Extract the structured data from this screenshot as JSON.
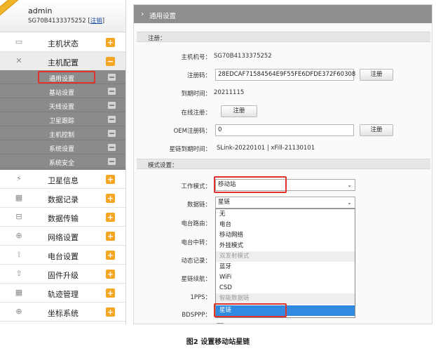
{
  "user": {
    "name": "admin",
    "serial": "SG70B4133375252",
    "logout_label": "注销"
  },
  "sidebar": {
    "items": [
      {
        "label": "主机状态",
        "icon": "monitor-icon",
        "badge": "+"
      },
      {
        "label": "主机配置",
        "icon": "tools-icon",
        "badge": "−"
      },
      {
        "label": "卫星信息",
        "icon": "satellite-icon",
        "badge": "+"
      },
      {
        "label": "数据记录",
        "icon": "calendar-icon",
        "badge": "+"
      },
      {
        "label": "数据传输",
        "icon": "transfer-icon",
        "badge": "+"
      },
      {
        "label": "网络设置",
        "icon": "globe-icon",
        "badge": "+"
      },
      {
        "label": "电台设置",
        "icon": "antenna-icon",
        "badge": "+"
      },
      {
        "label": "固件升级",
        "icon": "upload-icon",
        "badge": "+"
      },
      {
        "label": "轨迹管理",
        "icon": "calendar-icon",
        "badge": "+"
      },
      {
        "label": "坐标系统",
        "icon": "globe-icon",
        "badge": "+"
      }
    ],
    "subitems": [
      {
        "label": "通用设置"
      },
      {
        "label": "基站设置"
      },
      {
        "label": "天线设置"
      },
      {
        "label": "卫星跟踪"
      },
      {
        "label": "主机控制"
      },
      {
        "label": "系统设置"
      },
      {
        "label": "系统安全"
      }
    ]
  },
  "page": {
    "title": "通用设置"
  },
  "register": {
    "section_label": "注册：",
    "host_no_label": "主机机号：",
    "host_no_value": "SG70B4133375252",
    "reg_code_label": "注册码：",
    "reg_code_value": "28EDCAF71584564E9F55FE6DFDE372F60308",
    "register_button": "注册",
    "expire_label": "到期时间：",
    "expire_value": "20211115",
    "online_label": "在线注册：",
    "online_button": "注册",
    "oem_label": "OEM注册码：",
    "oem_value": "0",
    "oem_button": "注册",
    "starlink_label": "星链到期时间：",
    "starlink_value": "SLink-20220101 | xFill-21130101"
  },
  "mode": {
    "section_label": "模式设置：",
    "work_mode_label": "工作模式：",
    "work_mode_value": "移动站",
    "datalink_label": "数据链：",
    "datalink_value": "星链",
    "radio_route_label": "电台路由：",
    "radio_relay_label": "电台中转：",
    "dynamic_record_label": "动态记录：",
    "starlink_relay_label": "星链续航：",
    "pps_label": "1PPS：",
    "bdsppp_label": "BDSPPP："
  },
  "dropdown": {
    "options": [
      {
        "label": "无",
        "kind": "option"
      },
      {
        "label": "电台",
        "kind": "option"
      },
      {
        "label": "移动网络",
        "kind": "option"
      },
      {
        "label": "外挂模式",
        "kind": "option"
      },
      {
        "label": "双发射模式",
        "kind": "group"
      },
      {
        "label": "蓝牙",
        "kind": "option"
      },
      {
        "label": "WiFi",
        "kind": "option"
      },
      {
        "label": "CSD",
        "kind": "option"
      },
      {
        "label": "智能数据链",
        "kind": "group"
      },
      {
        "label": "星链",
        "kind": "selected"
      }
    ]
  },
  "caption": "图2 设置移动站星链",
  "colors": {
    "highlight_red": "#e0332d",
    "badge_orange": "#f5a623",
    "header_gray": "#8e8e8e",
    "selected_blue": "#2f8ae0"
  }
}
